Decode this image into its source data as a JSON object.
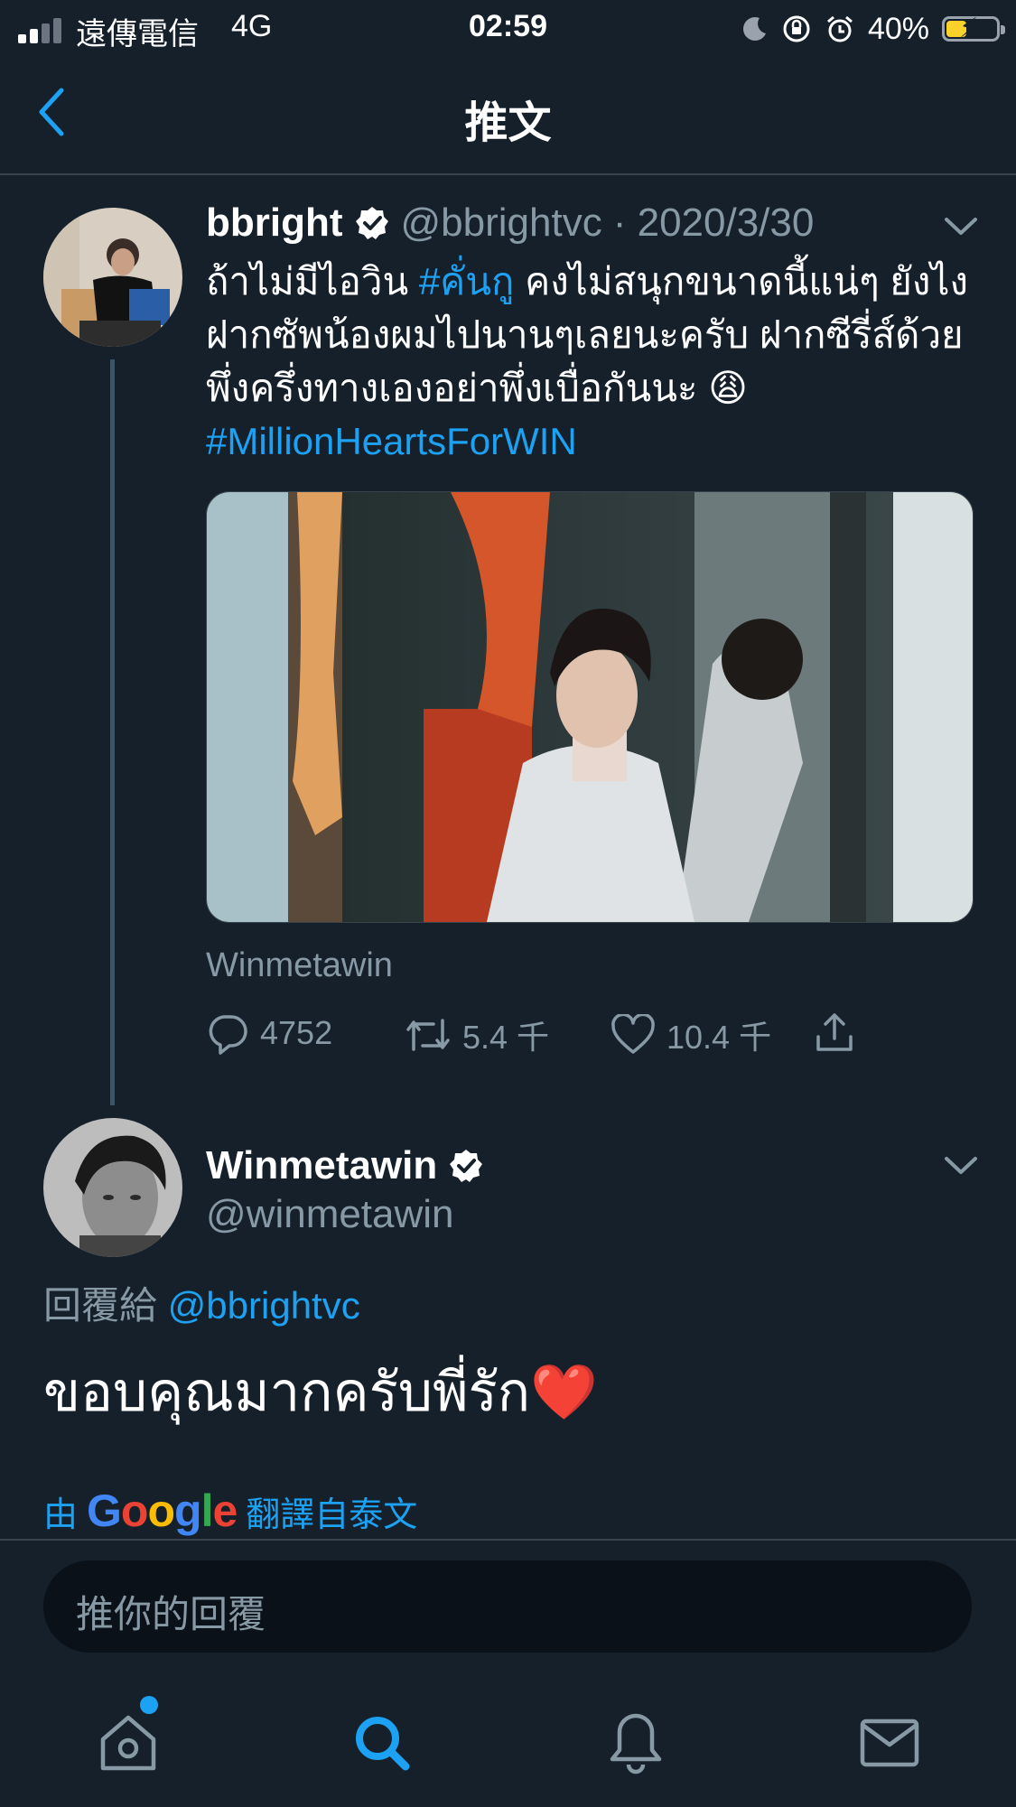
{
  "status_bar": {
    "carrier": "遠傳電信",
    "network": "4G",
    "time": "02:59",
    "battery_percent_text": "40%",
    "battery_level": 0.4
  },
  "header": {
    "title": "推文"
  },
  "tweet": {
    "author_name": "bbright",
    "handle": "@bbrightvc",
    "date": "· 2020/3/30",
    "text_part1": "ถ้าไม่มีไอวิน ",
    "hashtag1": "#คั่นกู",
    "text_part2": " คงไม่สนุกขนาดนี้แน่ๆ ยังไงฝากซัพน้องผมไปนานๆเลยนะครับ ฝากซีรี่ส์ด้วยพึ่งครึ่งทางเองอย่าพึ่งเบื่อกันนะ 😩",
    "hashtag2": "#MillionHeartsForWIN",
    "media_source": "Winmetawin",
    "replies": "4752",
    "retweets": "5.4 千",
    "likes": "10.4 千"
  },
  "reply": {
    "author_name": "Winmetawin",
    "handle": "@winmetawin",
    "reply_to_prefix": "回覆給 ",
    "reply_to_handle": "@bbrightvc",
    "text": "ขอบคุณมากครับพี่รัก❤️",
    "translate_prefix": "由",
    "translate_brand": "Google",
    "translate_suffix": "翻譯自泰文"
  },
  "composer": {
    "placeholder": "推你的回覆"
  },
  "tabs": [
    "home-icon",
    "search-icon",
    "notifications-icon",
    "messages-icon"
  ],
  "colors": {
    "background": "#15202b",
    "accent": "#1da1f2",
    "muted": "#8899a6"
  }
}
